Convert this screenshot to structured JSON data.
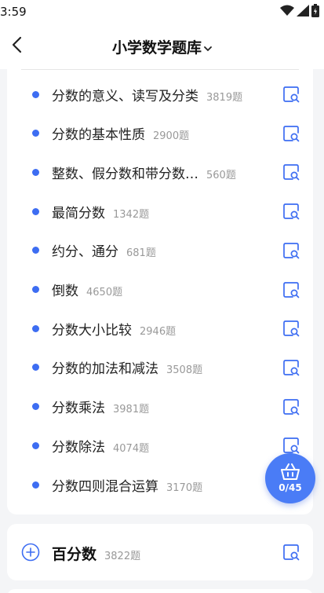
{
  "status_bar": {
    "time": "3:59"
  },
  "nav": {
    "title": "小学数学题库"
  },
  "topics": [
    {
      "name": "分数的意义、读写及分类",
      "count": "3819题"
    },
    {
      "name": "分数的基本性质",
      "count": "2900题"
    },
    {
      "name": "整数、假分数和带分数…",
      "count": "560题"
    },
    {
      "name": "最简分数",
      "count": "1342题"
    },
    {
      "name": "约分、通分",
      "count": "681题"
    },
    {
      "name": "倒数",
      "count": "4650题"
    },
    {
      "name": "分数大小比较",
      "count": "2946题"
    },
    {
      "name": "分数的加法和减法",
      "count": "3508题"
    },
    {
      "name": "分数乘法",
      "count": "3981题"
    },
    {
      "name": "分数除法",
      "count": "4074题"
    },
    {
      "name": "分数四则混合运算",
      "count": "3170题"
    }
  ],
  "basket": {
    "count": "0/45"
  },
  "section": {
    "name": "百分数",
    "count": "3822题"
  },
  "colors": {
    "accent": "#3d6df2",
    "fab": "#4a7cf6"
  },
  "icons": {
    "row_action": "search-doc-icon",
    "basket": "basket-icon",
    "expand": "plus-circle-icon"
  }
}
